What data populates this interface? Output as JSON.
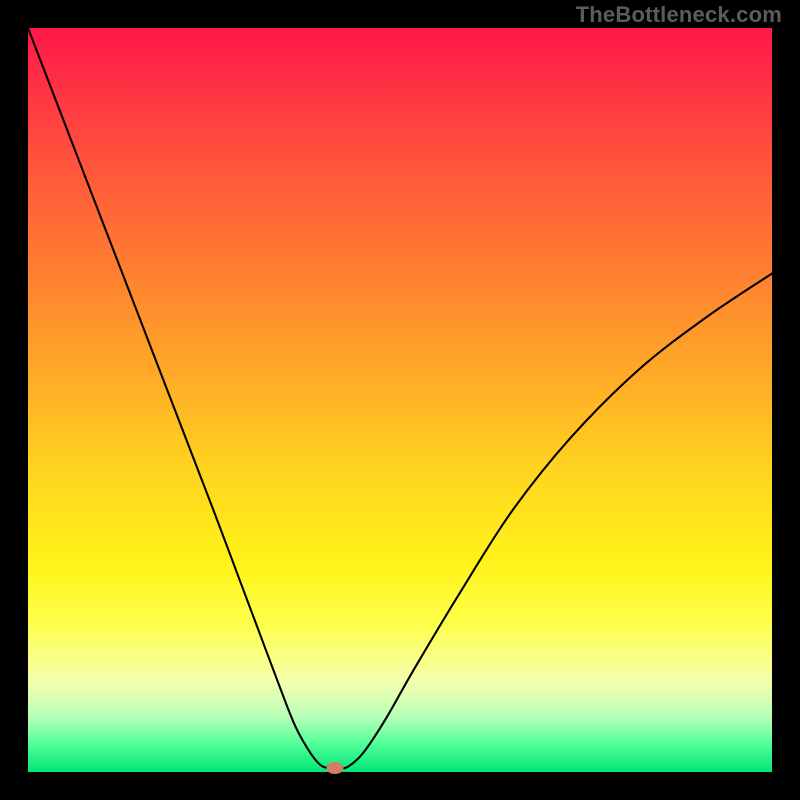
{
  "watermark": "TheBottleneck.com",
  "chart_data": {
    "type": "line",
    "title": "",
    "xlabel": "",
    "ylabel": "",
    "xlim": [
      0,
      100
    ],
    "ylim": [
      0,
      100
    ],
    "background": "rainbow-gradient-red-to-green-vertical",
    "series": [
      {
        "name": "bottleneck-curve",
        "x": [
          0,
          5,
          10,
          15,
          20,
          25,
          28,
          31,
          34,
          36,
          38,
          39.5,
          41,
          42,
          43,
          45,
          48,
          52,
          58,
          65,
          73,
          82,
          91,
          100
        ],
        "y": [
          100,
          87,
          74,
          61,
          48,
          35,
          27,
          19,
          11,
          6,
          2.5,
          0.8,
          0.5,
          0.5,
          0.7,
          2.5,
          7,
          14,
          24,
          35,
          45,
          54,
          61,
          67
        ]
      }
    ],
    "marker": {
      "x": 41.3,
      "y": 0.5,
      "color": "#d67a6a",
      "shape": "ellipse"
    }
  }
}
